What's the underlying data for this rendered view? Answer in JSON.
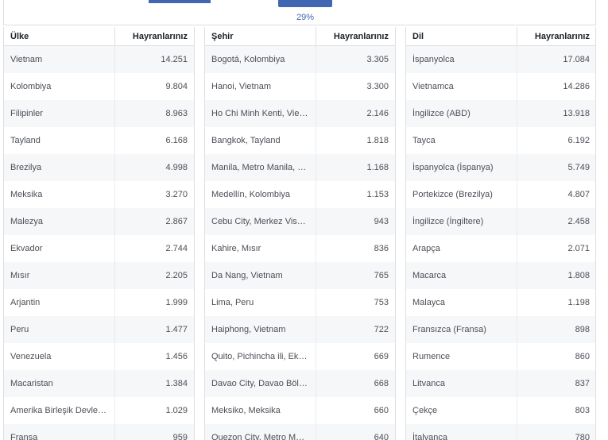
{
  "progress": {
    "label": "29%"
  },
  "country_table": {
    "headers": {
      "name": "Ülke",
      "fans": "Hayranlarınız"
    },
    "rows": [
      {
        "name": "Vietnam",
        "fans": "14.251"
      },
      {
        "name": "Kolombiya",
        "fans": "9.804"
      },
      {
        "name": "Filipinler",
        "fans": "8.963"
      },
      {
        "name": "Tayland",
        "fans": "6.168"
      },
      {
        "name": "Brezilya",
        "fans": "4.998"
      },
      {
        "name": "Meksika",
        "fans": "3.270"
      },
      {
        "name": "Malezya",
        "fans": "2.867"
      },
      {
        "name": "Ekvador",
        "fans": "2.744"
      },
      {
        "name": "Mısır",
        "fans": "2.205"
      },
      {
        "name": "Arjantin",
        "fans": "1.999"
      },
      {
        "name": "Peru",
        "fans": "1.477"
      },
      {
        "name": "Venezuela",
        "fans": "1.456"
      },
      {
        "name": "Macaristan",
        "fans": "1.384"
      },
      {
        "name": "Amerika Birleşik Devletleri",
        "fans": "1.029"
      },
      {
        "name": "Fransa",
        "fans": "959"
      }
    ]
  },
  "city_table": {
    "headers": {
      "name": "Şehir",
      "fans": "Hayranlarınız"
    },
    "rows": [
      {
        "name": "Bogotá, Kolombiya",
        "fans": "3.305"
      },
      {
        "name": "Hanoi, Vietnam",
        "fans": "3.300"
      },
      {
        "name": "Ho Chi Minh Kenti, Vietnam",
        "fans": "2.146"
      },
      {
        "name": "Bangkok, Tayland",
        "fans": "1.818"
      },
      {
        "name": "Manila, Metro Manila, Filipinler",
        "fans": "1.168"
      },
      {
        "name": "Medellín, Kolombiya",
        "fans": "1.153"
      },
      {
        "name": "Cebu City, Merkez Visayas",
        "fans": "943"
      },
      {
        "name": "Kahire, Mısır",
        "fans": "836"
      },
      {
        "name": "Da Nang, Vietnam",
        "fans": "765"
      },
      {
        "name": "Lima, Peru",
        "fans": "753"
      },
      {
        "name": "Haiphong, Vietnam",
        "fans": "722"
      },
      {
        "name": "Quito, Pichincha ili, Ekvador",
        "fans": "669"
      },
      {
        "name": "Davao City, Davao Bölgesi",
        "fans": "668"
      },
      {
        "name": "Meksiko, Meksika",
        "fans": "660"
      },
      {
        "name": "Quezon City, Metro Manila",
        "fans": "640"
      }
    ]
  },
  "language_table": {
    "headers": {
      "name": "Dil",
      "fans": "Hayranlarınız"
    },
    "rows": [
      {
        "name": "İspanyolca",
        "fans": "17.084"
      },
      {
        "name": "Vietnamca",
        "fans": "14.286"
      },
      {
        "name": "İngilizce (ABD)",
        "fans": "13.918"
      },
      {
        "name": "Tayca",
        "fans": "6.192"
      },
      {
        "name": "İspanyolca (İspanya)",
        "fans": "5.749"
      },
      {
        "name": "Portekizce (Brezilya)",
        "fans": "4.807"
      },
      {
        "name": "İngilizce (İngiltere)",
        "fans": "2.458"
      },
      {
        "name": "Arapça",
        "fans": "2.071"
      },
      {
        "name": "Macarca",
        "fans": "1.808"
      },
      {
        "name": "Malayca",
        "fans": "1.198"
      },
      {
        "name": "Fransızca (Fransa)",
        "fans": "898"
      },
      {
        "name": "Rumence",
        "fans": "860"
      },
      {
        "name": "Litvanca",
        "fans": "837"
      },
      {
        "name": "Çekçe",
        "fans": "803"
      },
      {
        "name": "İtalyanca",
        "fans": "780"
      }
    ]
  }
}
